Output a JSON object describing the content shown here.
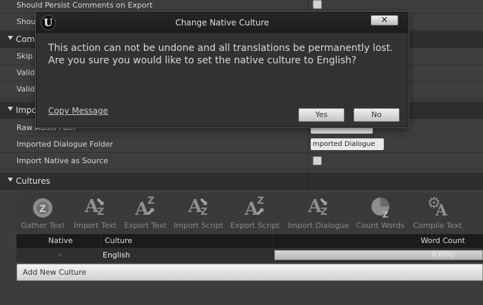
{
  "properties_top": [
    {
      "label": "Should Persist Comments on Export"
    },
    {
      "label": "Shoul"
    }
  ],
  "section_compile": {
    "title": "Comp"
  },
  "properties_compile": [
    {
      "label": "Skip"
    },
    {
      "label": "Valid"
    },
    {
      "label": "Valid"
    }
  ],
  "section_import": {
    "title": "Impo"
  },
  "properties_import": [
    {
      "label": "Raw Audio Path",
      "value": ""
    },
    {
      "label": "Imported Dialogue Folder",
      "value": "mported Dialogue"
    },
    {
      "label": "Import Native as Source"
    }
  ],
  "browse_dots": "•••",
  "section_cultures": {
    "title": "Cultures"
  },
  "toolbar": [
    {
      "label": "Gather Text",
      "icon": "gather-text-icon"
    },
    {
      "label": "Import Text",
      "icon": "import-text-icon"
    },
    {
      "label": "Export Text",
      "icon": "export-text-icon"
    },
    {
      "label": "Import Script",
      "icon": "import-script-icon"
    },
    {
      "label": "Export Script",
      "icon": "export-script-icon"
    },
    {
      "label": "Import Dialogue",
      "icon": "import-dialogue-icon"
    },
    {
      "label": "Count Words",
      "icon": "count-words-icon"
    },
    {
      "label": "Compile Text",
      "icon": "compile-text-icon"
    }
  ],
  "table": {
    "headers": {
      "native": "Native",
      "culture": "Culture",
      "word_count": "Word Count"
    },
    "rows": [
      {
        "culture": "English",
        "word_count": "0 (0%)",
        "progress": 0
      }
    ]
  },
  "add_culture_label": "Add New Culture",
  "dialog": {
    "title": "Change Native Culture",
    "logo": "U",
    "close_label": "✕",
    "message_line1": "This action can not be undone and all translations be permanently lost.",
    "message_line2": "Are you sure you would like to set the native culture to English?",
    "copy_label": "Copy Message",
    "yes_label": "Yes",
    "no_label": "No"
  }
}
